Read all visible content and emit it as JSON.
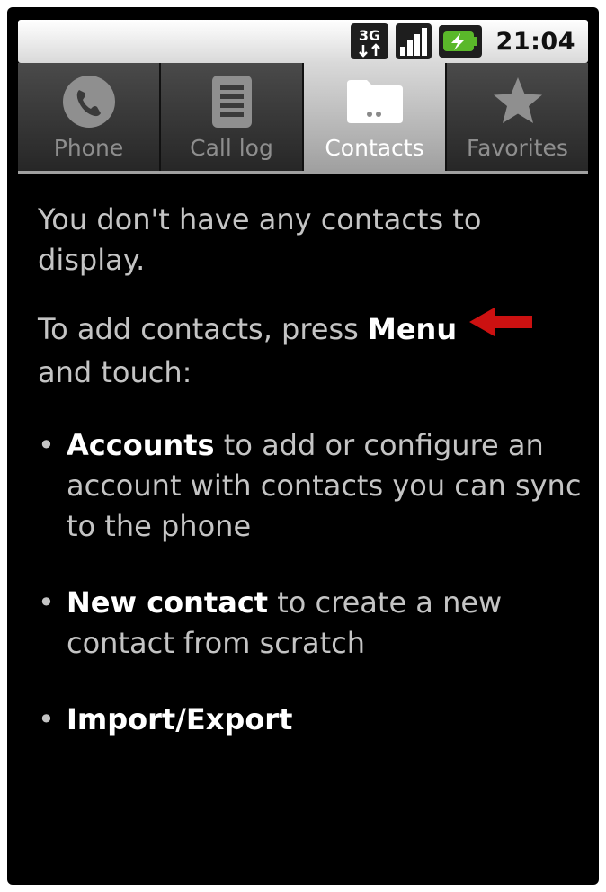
{
  "status_bar": {
    "network_type": "3G",
    "signal_icon": "signal-bars-icon",
    "battery_icon": "battery-charging-icon",
    "time": "21:04"
  },
  "tabs": [
    {
      "label": "Phone",
      "icon": "phone-icon",
      "active": false
    },
    {
      "label": "Call log",
      "icon": "call-log-icon",
      "active": false
    },
    {
      "label": "Contacts",
      "icon": "contacts-folder-icon",
      "active": true
    },
    {
      "label": "Favorites",
      "icon": "star-icon",
      "active": false
    }
  ],
  "empty_state": {
    "title": "You don't have any contacts to display.",
    "instruction_prefix": "To add contacts, press ",
    "instruction_key": "Menu",
    "instruction_suffix": " and touch:",
    "items": [
      {
        "bold": "Accounts",
        "rest": " to add or configure an account with contacts you can sync to the phone"
      },
      {
        "bold": "New contact",
        "rest": " to create a new contact from scratch"
      },
      {
        "bold": "Import/Export",
        "rest": ""
      }
    ]
  },
  "colors": {
    "background": "#000000",
    "text": "#c4c4c4",
    "highlight": "#ffffff",
    "arrow": "#cc1111",
    "active_tab": "#bdbdbd",
    "inactive_tab": "#333333"
  }
}
